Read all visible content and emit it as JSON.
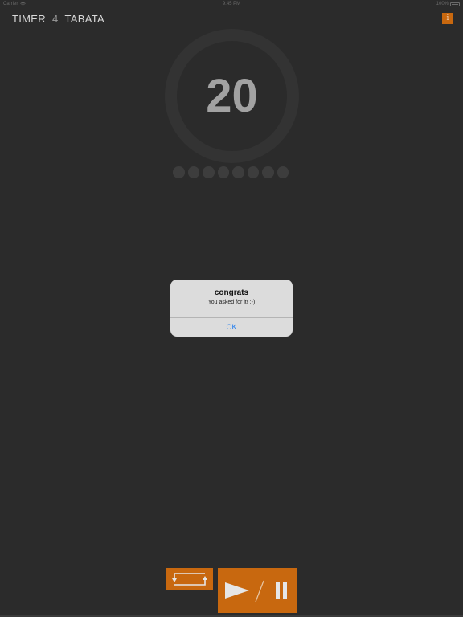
{
  "status_bar": {
    "carrier": "Carrier",
    "time": "9:45 PM",
    "battery": "100%"
  },
  "header": {
    "title_left": "TIMER",
    "title_number": "4",
    "title_right": "TABATA",
    "info_label": "i"
  },
  "timer": {
    "value": "20",
    "round_dots": 8
  },
  "alert": {
    "title": "congrats",
    "message": "You asked for it! :-)",
    "ok_label": "OK"
  },
  "colors": {
    "accent": "#c8680f",
    "background": "#2b2b2b",
    "ring": "#333333",
    "alert_link": "#1e7cf0"
  },
  "controls": {
    "loop_icon": "loop-icon",
    "play_icon": "play-icon",
    "pause_icon": "pause-icon"
  }
}
